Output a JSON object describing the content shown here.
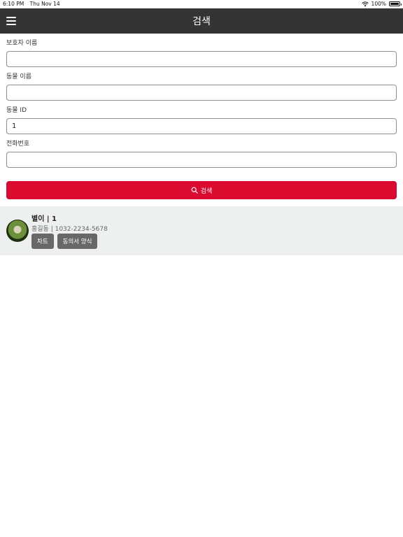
{
  "status_bar": {
    "time": "6:10 PM",
    "date": "Thu Nov 14",
    "battery_text": "100%",
    "battery_level": 1.0
  },
  "header": {
    "title": "검색",
    "menu_icon": "hamburger-menu-icon"
  },
  "form": {
    "guardian_name_label": "보호자 이름",
    "guardian_name_value": "",
    "animal_name_label": "동물 이름",
    "animal_name_value": "",
    "animal_id_label": "동물 ID",
    "animal_id_value": "1",
    "phone_label": "전화번호",
    "phone_value": ""
  },
  "search_button": {
    "icon": "search-icon",
    "label": "검색"
  },
  "colors": {
    "header_bg": "#343434",
    "accent": "#db0a2f",
    "card_bg": "#eef0ef",
    "action_button_bg": "#686868"
  },
  "results": [
    {
      "title": "별이 | 1",
      "subtitle": "홍길동 | 1032-2234-5678",
      "chart_button": "차트",
      "consent_button": "동의서 양식"
    }
  ]
}
